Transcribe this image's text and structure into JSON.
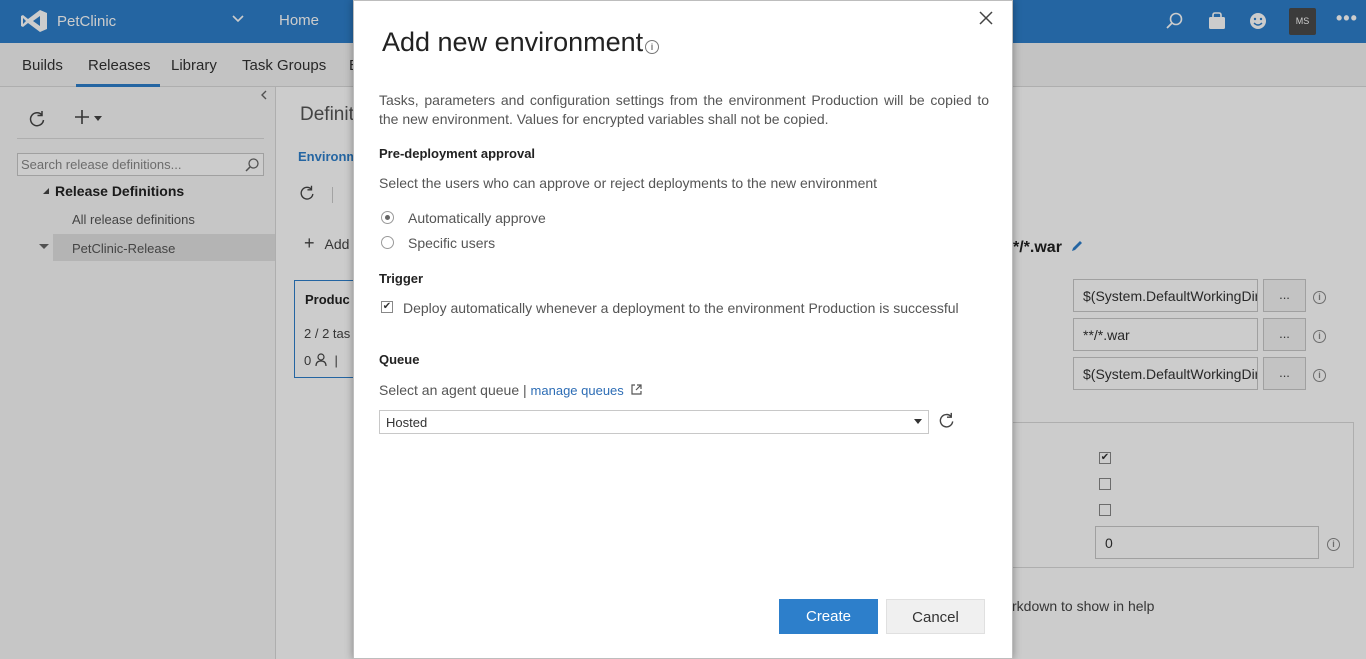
{
  "topbar": {
    "project": "PetClinic",
    "home": "Home",
    "avatar_initials": "MS",
    "more": "•••",
    "colors": {
      "bar": "#2d7fcb"
    }
  },
  "subnav": {
    "tabs": [
      {
        "label": "Builds"
      },
      {
        "label": "Releases",
        "active": true
      },
      {
        "label": "Library"
      },
      {
        "label": "Task Groups"
      },
      {
        "label": "E"
      }
    ]
  },
  "sidebar": {
    "search_placeholder": "Search release definitions...",
    "tree_header": "Release Definitions",
    "tree_items": [
      "All release definitions",
      "PetClinic-Release"
    ]
  },
  "background": {
    "definition_title": "Definiti",
    "env_tab": "Environm",
    "add_label": "Add",
    "card": {
      "name": "Produc",
      "tasks": "2 / 2 tas",
      "approvers": "0"
    },
    "artifact_title": "*/*.war",
    "fields": [
      "$(System.DefaultWorkingDirectory)",
      "**/*.war",
      "$(System.DefaultWorkingDirectory)"
    ],
    "dots_label": "...",
    "number_field": "0",
    "help_text": "rkdown to show in help"
  },
  "dialog": {
    "title": "Add new environment",
    "description": "Tasks, parameters and configuration settings from the environment Production will be copied to the new environment. Values for encrypted variables shall not be copied.",
    "approval": {
      "heading": "Pre-deployment approval",
      "subtext": "Select the users who can approve or reject deployments to the new environment",
      "options": [
        "Automatically approve",
        "Specific users"
      ],
      "selected": "Automatically approve"
    },
    "trigger": {
      "heading": "Trigger",
      "checkbox_label": "Deploy automatically whenever a deployment to the environment Production is successful",
      "checked": true
    },
    "queue": {
      "heading": "Queue",
      "subtext": "Select an agent queue | ",
      "link": "manage queues",
      "selected": "Hosted"
    },
    "create_label": "Create",
    "cancel_label": "Cancel"
  }
}
